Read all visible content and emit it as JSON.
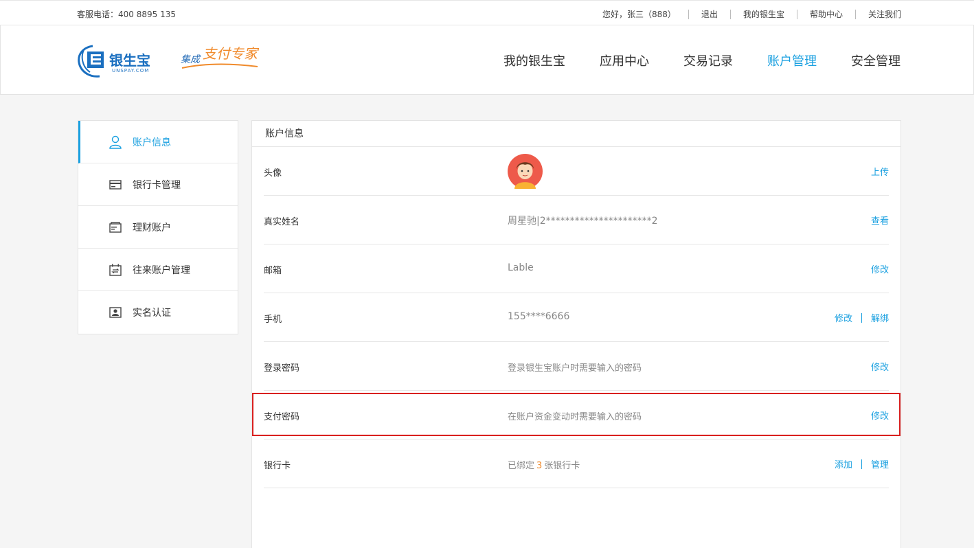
{
  "topbar": {
    "phone": "客服电话：400 8895 135",
    "greeting": "您好，张三（888）",
    "links": [
      "退出",
      "我的银生宝",
      "帮助中心",
      "关注我们"
    ]
  },
  "logo": {
    "brand": "银生宝",
    "brand_en": "UNSPAY.COM",
    "slogan_a": "集成",
    "slogan_b": "支付专家"
  },
  "nav": {
    "items": [
      "我的银生宝",
      "应用中心",
      "交易记录",
      "账户管理",
      "安全管理"
    ],
    "active_index": 3
  },
  "sidebar": {
    "items": [
      {
        "label": "账户信息",
        "icon": "user-icon",
        "active": true
      },
      {
        "label": "银行卡管理",
        "icon": "bank-card-icon",
        "active": false
      },
      {
        "label": "理财账户",
        "icon": "wallet-icon",
        "active": false
      },
      {
        "label": "往来账户管理",
        "icon": "calendar-transfer-icon",
        "active": false
      },
      {
        "label": "实名认证",
        "icon": "id-card-icon",
        "active": false
      }
    ]
  },
  "panel": {
    "title": "账户信息",
    "rows": {
      "avatar": {
        "label": "头像",
        "action": "上传"
      },
      "realname": {
        "label": "真实姓名",
        "value": "周星驰|2**********************2",
        "action": "查看"
      },
      "email": {
        "label": "邮箱",
        "value": "Lable",
        "action": "修改"
      },
      "phone": {
        "label": "手机",
        "value": "155****6666",
        "action1": "修改",
        "action2": "解绑"
      },
      "login_pwd": {
        "label": "登录密码",
        "value": "登录银生宝账户时需要输入的密码",
        "action": "修改"
      },
      "pay_pwd": {
        "label": "支付密码",
        "value": "在账户资金变动时需要输入的密码",
        "action": "修改"
      },
      "bank_card": {
        "label": "银行卡",
        "value_prefix": "已绑定",
        "count": "3",
        "value_suffix": "张银行卡",
        "action1": "添加",
        "action2": "管理"
      }
    }
  },
  "colors": {
    "accent": "#1aa0e0",
    "highlight": "#d9201f",
    "orange": "#f08a2b"
  }
}
